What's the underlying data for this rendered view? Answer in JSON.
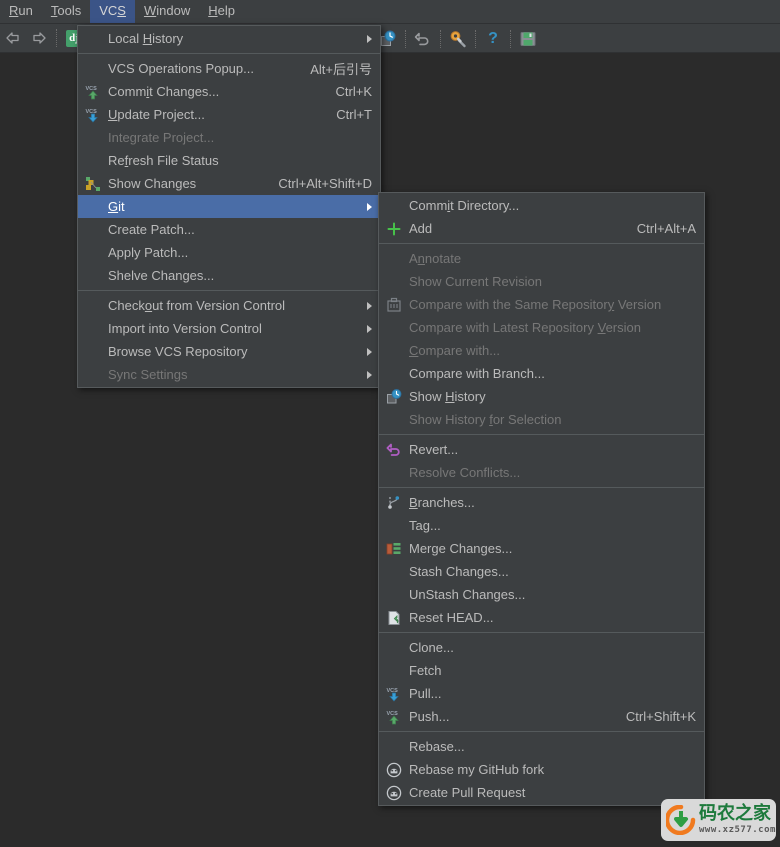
{
  "menubar": {
    "items": [
      {
        "label": "Run",
        "mnemonic": "R",
        "active": false
      },
      {
        "label": "Tools",
        "mnemonic": "T",
        "active": false
      },
      {
        "label": "VCS",
        "mnemonic": "S",
        "active": true
      },
      {
        "label": "Window",
        "mnemonic": "W",
        "active": false
      },
      {
        "label": "Help",
        "mnemonic": "H",
        "active": false
      }
    ]
  },
  "toolbar": {
    "back_label": "Back",
    "forward_label": "Forward",
    "django_label": "dj",
    "history_label": "Show History",
    "undo_label": "Undo",
    "settings_label": "Settings",
    "help_label": "Help",
    "save_label": "Save All"
  },
  "vcs_menu": {
    "items": [
      {
        "label": "Local History",
        "mnemonic": "H",
        "accel": "",
        "icon": "",
        "submenu": true,
        "disabled": false,
        "selected": false
      },
      {
        "separator": true
      },
      {
        "label": "VCS Operations Popup...",
        "mnemonic": "",
        "accel": "Alt+后引号",
        "icon": "",
        "submenu": false,
        "disabled": false,
        "selected": false
      },
      {
        "label": "Commit Changes...",
        "mnemonic": "i",
        "accel": "Ctrl+K",
        "icon": "vcs-commit-icon",
        "submenu": false,
        "disabled": false,
        "selected": false
      },
      {
        "label": "Update Project...",
        "mnemonic": "U",
        "accel": "Ctrl+T",
        "icon": "vcs-update-icon",
        "submenu": false,
        "disabled": false,
        "selected": false
      },
      {
        "label": "Integrate Project...",
        "mnemonic": "",
        "accel": "",
        "icon": "",
        "submenu": false,
        "disabled": true,
        "selected": false
      },
      {
        "label": "Refresh File Status",
        "mnemonic": "f",
        "accel": "",
        "icon": "",
        "submenu": false,
        "disabled": false,
        "selected": false
      },
      {
        "label": "Show Changes",
        "mnemonic": "",
        "accel": "Ctrl+Alt+Shift+D",
        "icon": "show-changes-icon",
        "submenu": false,
        "disabled": false,
        "selected": false
      },
      {
        "label": "Git",
        "mnemonic": "G",
        "accel": "",
        "icon": "",
        "submenu": true,
        "disabled": false,
        "selected": true
      },
      {
        "label": "Create Patch...",
        "mnemonic": "",
        "accel": "",
        "icon": "",
        "submenu": false,
        "disabled": false,
        "selected": false
      },
      {
        "label": "Apply Patch...",
        "mnemonic": "",
        "accel": "",
        "icon": "",
        "submenu": false,
        "disabled": false,
        "selected": false
      },
      {
        "label": "Shelve Changes...",
        "mnemonic": "",
        "accel": "",
        "icon": "",
        "submenu": false,
        "disabled": false,
        "selected": false
      },
      {
        "separator": true
      },
      {
        "label": "Checkout from Version Control",
        "mnemonic": "o",
        "accel": "",
        "icon": "",
        "submenu": true,
        "disabled": false,
        "selected": false
      },
      {
        "label": "Import into Version Control",
        "mnemonic": "",
        "accel": "",
        "icon": "",
        "submenu": true,
        "disabled": false,
        "selected": false
      },
      {
        "label": "Browse VCS Repository",
        "mnemonic": "",
        "accel": "",
        "icon": "",
        "submenu": true,
        "disabled": false,
        "selected": false
      },
      {
        "label": "Sync Settings",
        "mnemonic": "",
        "accel": "",
        "icon": "",
        "submenu": true,
        "disabled": true,
        "selected": false
      }
    ]
  },
  "git_menu": {
    "items": [
      {
        "label": "Commit Directory...",
        "mnemonic": "i",
        "accel": "",
        "icon": "",
        "submenu": false,
        "disabled": false
      },
      {
        "label": "Add",
        "mnemonic": "",
        "accel": "Ctrl+Alt+A",
        "icon": "add-plus-icon",
        "submenu": false,
        "disabled": false
      },
      {
        "separator": true
      },
      {
        "label": "Annotate",
        "mnemonic": "n",
        "accel": "",
        "icon": "",
        "submenu": false,
        "disabled": true
      },
      {
        "label": "Show Current Revision",
        "mnemonic": "",
        "accel": "",
        "icon": "",
        "submenu": false,
        "disabled": true
      },
      {
        "label": "Compare with the Same Repository Version",
        "mnemonic": "y",
        "accel": "",
        "icon": "compare-repo-icon",
        "submenu": false,
        "disabled": true
      },
      {
        "label": "Compare with Latest Repository Version",
        "mnemonic": "V",
        "accel": "",
        "icon": "",
        "submenu": false,
        "disabled": true
      },
      {
        "label": "Compare with...",
        "mnemonic": "C",
        "accel": "",
        "icon": "",
        "submenu": false,
        "disabled": true
      },
      {
        "label": "Compare with Branch...",
        "mnemonic": "",
        "accel": "",
        "icon": "",
        "submenu": false,
        "disabled": false
      },
      {
        "label": "Show History",
        "mnemonic": "H",
        "accel": "",
        "icon": "show-history-icon",
        "submenu": false,
        "disabled": false
      },
      {
        "label": "Show History for Selection",
        "mnemonic": "f",
        "accel": "",
        "icon": "",
        "submenu": false,
        "disabled": true
      },
      {
        "separator": true
      },
      {
        "label": "Revert...",
        "mnemonic": "",
        "accel": "",
        "icon": "revert-icon",
        "submenu": false,
        "disabled": false
      },
      {
        "label": "Resolve Conflicts...",
        "mnemonic": "",
        "accel": "",
        "icon": "",
        "submenu": false,
        "disabled": true
      },
      {
        "separator": true
      },
      {
        "label": "Branches...",
        "mnemonic": "B",
        "accel": "",
        "icon": "branches-icon",
        "submenu": false,
        "disabled": false
      },
      {
        "label": "Tag...",
        "mnemonic": "",
        "accel": "",
        "icon": "",
        "submenu": false,
        "disabled": false
      },
      {
        "label": "Merge Changes...",
        "mnemonic": "",
        "accel": "",
        "icon": "merge-icon",
        "submenu": false,
        "disabled": false
      },
      {
        "label": "Stash Changes...",
        "mnemonic": "",
        "accel": "",
        "icon": "",
        "submenu": false,
        "disabled": false
      },
      {
        "label": "UnStash Changes...",
        "mnemonic": "",
        "accel": "",
        "icon": "",
        "submenu": false,
        "disabled": false
      },
      {
        "label": "Reset HEAD...",
        "mnemonic": "",
        "accel": "",
        "icon": "reset-head-icon",
        "submenu": false,
        "disabled": false
      },
      {
        "separator": true
      },
      {
        "label": "Clone...",
        "mnemonic": "",
        "accel": "",
        "icon": "",
        "submenu": false,
        "disabled": false
      },
      {
        "label": "Fetch",
        "mnemonic": "",
        "accel": "",
        "icon": "",
        "submenu": false,
        "disabled": false
      },
      {
        "label": "Pull...",
        "mnemonic": "",
        "accel": "",
        "icon": "vcs-update-icon",
        "submenu": false,
        "disabled": false
      },
      {
        "label": "Push...",
        "mnemonic": "",
        "accel": "Ctrl+Shift+K",
        "icon": "vcs-commit-icon",
        "submenu": false,
        "disabled": false
      },
      {
        "separator": true
      },
      {
        "label": "Rebase...",
        "mnemonic": "",
        "accel": "",
        "icon": "",
        "submenu": false,
        "disabled": false
      },
      {
        "label": "Rebase my GitHub fork",
        "mnemonic": "",
        "accel": "",
        "icon": "github-icon",
        "submenu": false,
        "disabled": false
      },
      {
        "label": "Create Pull Request",
        "mnemonic": "",
        "accel": "",
        "icon": "github-icon",
        "submenu": false,
        "disabled": false
      }
    ]
  },
  "watermark": {
    "title": "码农之家",
    "url": "www.xz577.com"
  },
  "colors": {
    "menu_bg": "#3c3f41",
    "editor_bg": "#2b2b2b",
    "highlight": "#4a6da7",
    "menubar_highlight": "#3b5487",
    "text": "#bbbbbb",
    "text_disabled": "#777777"
  }
}
